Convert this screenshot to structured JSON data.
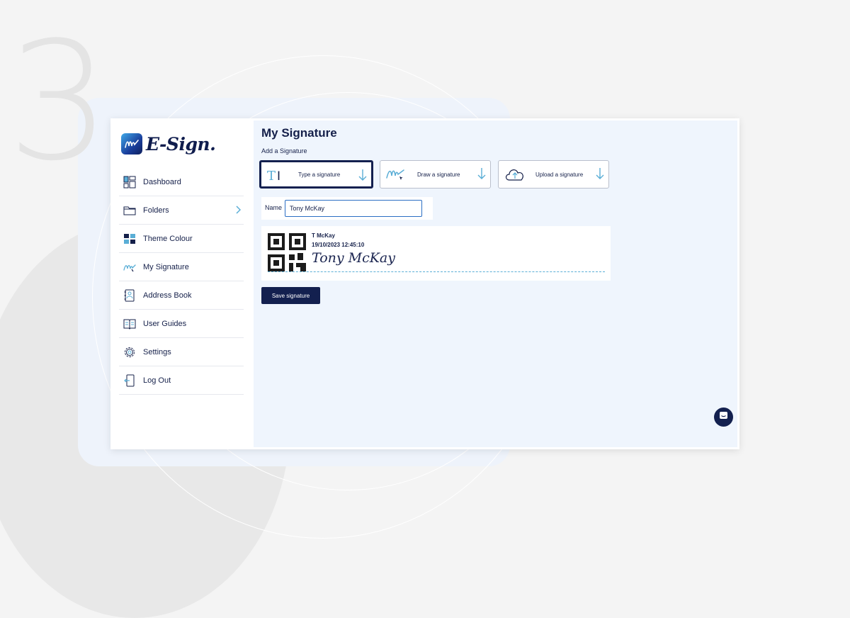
{
  "backdrop": {
    "step_number": "3"
  },
  "logo": {
    "text": "E-Sign."
  },
  "sidebar": {
    "items": [
      {
        "label": "Dashboard",
        "icon": "dashboard-icon"
      },
      {
        "label": "Folders",
        "icon": "folder-icon",
        "has_chevron": true
      },
      {
        "label": "Theme Colour",
        "icon": "theme-icon"
      },
      {
        "label": "My Signature",
        "icon": "signature-icon"
      },
      {
        "label": "Address Book",
        "icon": "address-book-icon"
      },
      {
        "label": "User Guides",
        "icon": "book-icon"
      },
      {
        "label": "Settings",
        "icon": "gear-icon"
      },
      {
        "label": "Log Out",
        "icon": "logout-icon"
      }
    ]
  },
  "main": {
    "title": "My Signature",
    "subtitle": "Add a Signature",
    "options": [
      {
        "label": "Type a signature",
        "icon": "type-text-icon",
        "selected": true
      },
      {
        "label": "Draw a signature",
        "icon": "draw-pen-icon",
        "selected": false
      },
      {
        "label": "Upload a signature",
        "icon": "cloud-upload-icon",
        "selected": false
      }
    ],
    "name_label": "Name",
    "name_value": "Tony McKay",
    "preview": {
      "initials_name": "T McKay",
      "timestamp": "19/10/2023 12:45:10",
      "script_text": "Tony McKay"
    },
    "save_label": "Save signature"
  },
  "colors": {
    "primary": "#13204f",
    "accent": "#5aaed6",
    "panel_bg": "#eff5fd"
  }
}
